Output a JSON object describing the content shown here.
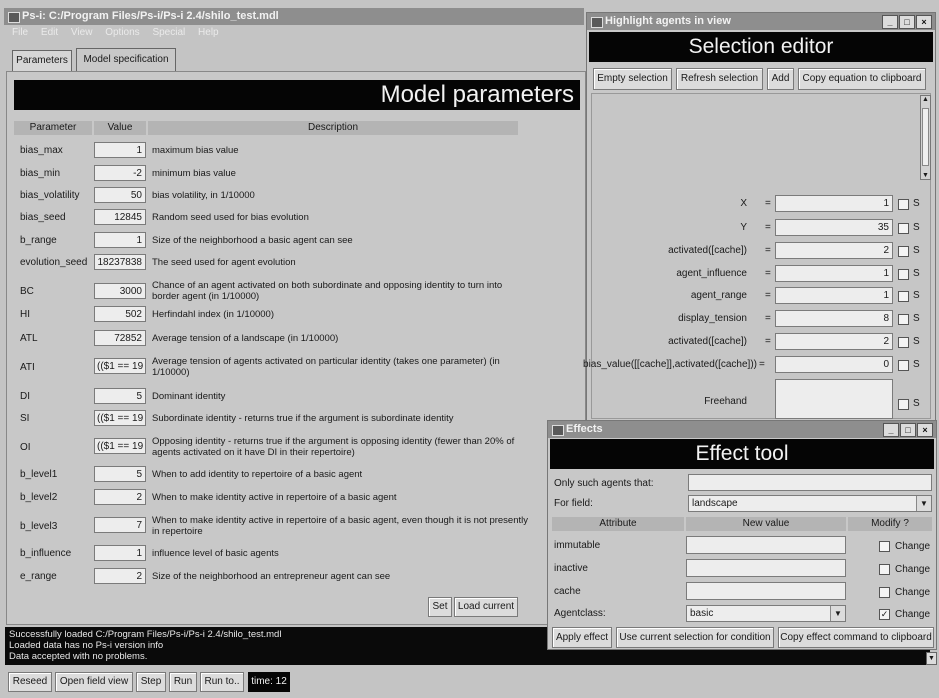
{
  "main_window": {
    "title": "Ps-i: C:/Program Files/Ps-i/Ps-i 2.4/shilo_test.mdl",
    "menu": [
      "File",
      "Edit",
      "View",
      "Options",
      "Special",
      "Help"
    ],
    "tabs": [
      "Parameters",
      "Model specification"
    ],
    "header": "Model parameters",
    "columns": [
      "Parameter",
      "Value",
      "Description"
    ],
    "rows": [
      {
        "param": "bias_max",
        "value": "1",
        "desc": "maximum bias value"
      },
      {
        "param": "bias_min",
        "value": "-2",
        "desc": "minimum bias value"
      },
      {
        "param": "bias_volatility",
        "value": "50",
        "desc": "bias volatility, in 1/10000"
      },
      {
        "param": "bias_seed",
        "value": "12845",
        "desc": "Random seed used for bias evolution"
      },
      {
        "param": "b_range",
        "value": "1",
        "desc": "Size of the neighborhood a basic agent can see"
      },
      {
        "param": "evolution_seed",
        "value": "18237838",
        "desc": "The seed used for agent evolution"
      },
      {
        "param": "BC",
        "value": "3000",
        "desc": "Chance of an agent activated on both subordinate and opposing identity to turn into border agent (in 1/10000)"
      },
      {
        "param": "HI",
        "value": "502",
        "desc": "Herfindahl index (in 1/10000)"
      },
      {
        "param": "ATL",
        "value": "72852",
        "desc": "Average tension of a landscape (in 1/10000)"
      },
      {
        "param": "ATI",
        "value": "(($1 == 19",
        "desc": "Average tension of agents activated on particular identity (takes one parameter) (in 1/10000)"
      },
      {
        "param": "DI",
        "value": "5",
        "desc": "Dominant identity"
      },
      {
        "param": "SI",
        "value": "(($1 == 19",
        "desc": "Subordinate identity - returns true if the argument is subordinate identity"
      },
      {
        "param": "OI",
        "value": "(($1 == 19",
        "desc": "Opposing identity - returns true if the argument is opposing identity (fewer than 20% of agents activated on it have DI in their repertoire)"
      },
      {
        "param": "b_level1",
        "value": "5",
        "desc": "When to add identity to repertoire of a basic agent"
      },
      {
        "param": "b_level2",
        "value": "2",
        "desc": "When to make identity active in repertoire of a basic agent"
      },
      {
        "param": "b_level3",
        "value": "7",
        "desc": "When to make identity active in repertoire of a basic agent, even though it is not presently in repertoire"
      },
      {
        "param": "b_influence",
        "value": "1",
        "desc": "influence level of basic agents"
      },
      {
        "param": "e_range",
        "value": "2",
        "desc": "Size of the neighborhood an entrepreneur agent can see"
      }
    ],
    "set_label": "Set",
    "load_current_label": "Load current",
    "log": [
      "Successfully loaded C:/Program Files/Ps-i/Ps-i 2.4/shilo_test.mdl",
      "Loaded data has no Ps-i version info",
      "Data accepted with no problems."
    ],
    "toolbar": {
      "reseed": "Reseed",
      "open_field_view": "Open field view",
      "step": "Step",
      "run": "Run",
      "run_to": "Run to..",
      "time": "time: 12"
    }
  },
  "selection_window": {
    "title": "Highlight agents in view",
    "header": "Selection editor",
    "buttons": [
      "Empty selection",
      "Refresh selection",
      "Add",
      "Copy equation to clipboard"
    ],
    "fields": [
      {
        "label": "X",
        "value": "1"
      },
      {
        "label": "Y",
        "value": "35"
      },
      {
        "label": "activated([cache])",
        "value": "2"
      },
      {
        "label": "agent_influence",
        "value": "1"
      },
      {
        "label": "agent_range",
        "value": "1"
      },
      {
        "label": "display_tension",
        "value": "8"
      },
      {
        "label": "activated([cache])",
        "value": "2"
      },
      {
        "label": "bias_value([[cache]],activated([cache]))",
        "value": "0"
      }
    ],
    "eq": "=",
    "cb_label": "S",
    "freehand_label": "Freehand"
  },
  "effects_window": {
    "title": "Effects",
    "header": "Effect tool",
    "only_label": "Only such agents that:",
    "field_label": "For field:",
    "field_value": "landscape",
    "col_attribute": "Attribute",
    "col_new_value": "New value",
    "col_modify": "Modify ?",
    "attributes": [
      {
        "name": "immutable",
        "value": "",
        "checked": false
      },
      {
        "name": "inactive",
        "value": "",
        "checked": false
      },
      {
        "name": "cache",
        "value": "",
        "checked": false
      }
    ],
    "agentclass_label": "Agentclass:",
    "agentclass_value": "basic",
    "agentclass_checked": true,
    "change_label": "Change",
    "buttons": [
      "Apply effect",
      "Use current selection for condition",
      "Copy effect command to clipboard"
    ]
  }
}
